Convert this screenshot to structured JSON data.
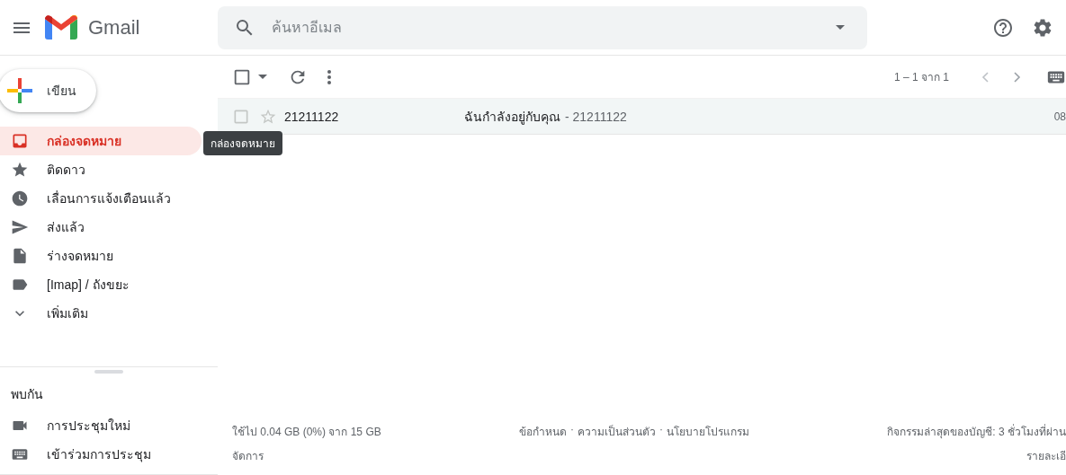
{
  "header": {
    "app_name": "Gmail",
    "search": {
      "placeholder": "ค้นหาอีเมล"
    }
  },
  "compose": {
    "label": "เขียน"
  },
  "nav": [
    {
      "label": "กล่องจดหมาย",
      "selected": true
    },
    {
      "label": "ติดดาว",
      "selected": false
    },
    {
      "label": "เลื่อนการแจ้งเตือนแล้ว",
      "selected": false
    },
    {
      "label": "ส่งแล้ว",
      "selected": false
    },
    {
      "label": "ร่างจดหมาย",
      "selected": false
    },
    {
      "label": "[Imap] / ถังขยะ",
      "selected": false
    },
    {
      "label": "เพิ่มเติม",
      "selected": false
    }
  ],
  "tooltip": "กล่องจดหมาย",
  "meet": {
    "title": "พบกัน",
    "items": [
      {
        "label": "การประชุมใหม่"
      },
      {
        "label": "เข้าร่วมการประชุม"
      }
    ]
  },
  "toolbar": {
    "select_checked": false,
    "page_info": "1 – 1 จาก 1"
  },
  "emails": [
    {
      "sender": "21211122",
      "subject": "ฉันกำลังอยู่กับคุณ",
      "snippet": "- 21211122",
      "date": "08",
      "checked": false,
      "starred": false
    }
  ],
  "footer": {
    "storage": "ใช้ไป 0.04 GB (0%) จาก 15 GB",
    "manage": "จัดการ",
    "links": [
      "ข้อกำหนด",
      "ความเป็นส่วนตัว",
      "นโยบายโปรแกรม"
    ],
    "separator": "·",
    "activity": "กิจกรรมล่าสุดของบัญชี: 3 ชั่วโมงที่ผ่าน",
    "details": "รายละเอี"
  }
}
